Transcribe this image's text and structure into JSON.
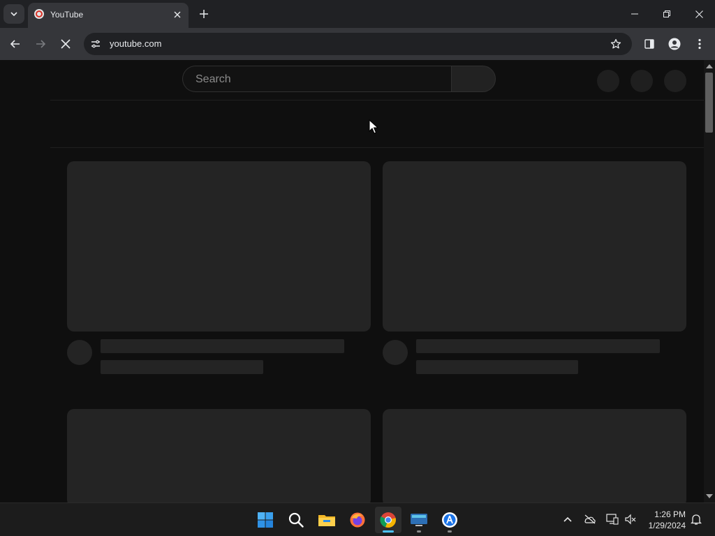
{
  "browser": {
    "tab": {
      "title": "YouTube"
    },
    "address": {
      "url": "youtube.com"
    }
  },
  "youtube": {
    "search": {
      "placeholder": "Search"
    }
  },
  "taskbar": {
    "apps": [
      "windows-start",
      "search",
      "file-explorer",
      "firefox",
      "chrome",
      "remote-desktop",
      "app-store"
    ],
    "clock": {
      "time": "1:26 PM",
      "date": "1/29/2024"
    }
  },
  "colors": {
    "page_bg": "#0f0f0f",
    "skeleton": "#242424",
    "accent_indicator": "#4cc2ff"
  }
}
